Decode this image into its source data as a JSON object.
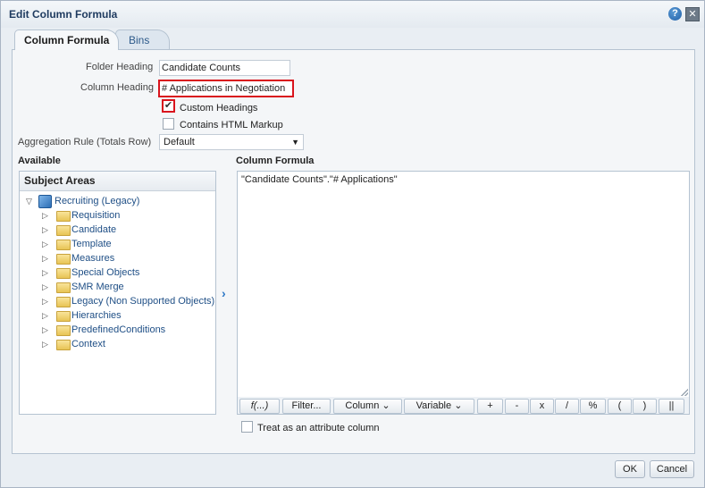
{
  "dialog": {
    "title": "Edit Column Formula"
  },
  "tabs": [
    {
      "label": "Column Formula",
      "active": true
    },
    {
      "label": "Bins",
      "active": false
    }
  ],
  "form": {
    "folder_heading_label": "Folder Heading",
    "folder_heading_value": "Candidate Counts",
    "column_heading_label": "Column Heading",
    "column_heading_value": "# Applications in Negotiation",
    "custom_headings_label": "Custom Headings",
    "custom_headings_checked": true,
    "contains_html_label": "Contains HTML Markup",
    "contains_html_checked": false,
    "aggregation_label": "Aggregation Rule (Totals Row)",
    "aggregation_value": "Default"
  },
  "available": {
    "title": "Available",
    "panel_title": "Subject Areas",
    "root": "Recruiting (Legacy)",
    "items": [
      "Requisition",
      "Candidate",
      "Template",
      "Measures",
      "Special Objects",
      "SMR Merge",
      "Legacy (Non Supported Objects)",
      "Hierarchies",
      "PredefinedConditions",
      "Context"
    ]
  },
  "formula": {
    "title": "Column Formula",
    "value": "\"Candidate Counts\".\"# Applications\"",
    "toolbar": {
      "fx": "f(...)",
      "filter": "Filter...",
      "column": "Column",
      "variable": "Variable",
      "plus": "+",
      "minus": "-",
      "times": "x",
      "divide": "/",
      "percent": "%",
      "lparen": "(",
      "rparen": ")",
      "concat": "||"
    }
  },
  "attribute_label": "Treat as an attribute column",
  "attribute_checked": false,
  "buttons": {
    "ok": "OK",
    "cancel": "Cancel"
  },
  "colors": {
    "highlight": "#d9141d",
    "link": "#1f4f86"
  }
}
